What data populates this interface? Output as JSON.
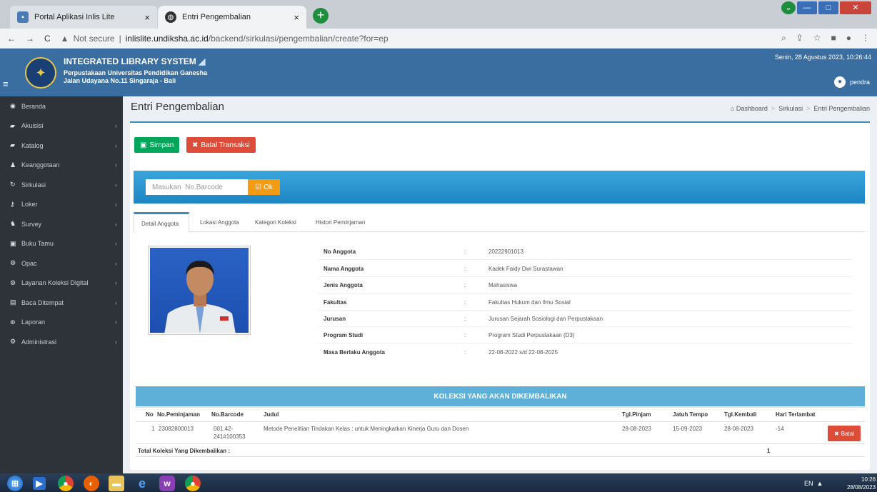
{
  "browser": {
    "tabs": [
      {
        "title": "Portal Aplikasi Inlis Lite"
      },
      {
        "title": "Entri Pengembalian"
      }
    ],
    "url_security": "Not secure",
    "url_host": "inlislite.undiksha.ac.id",
    "url_path": "/backend/sirkulasi/pengembalian/create?for=ep"
  },
  "header": {
    "title": "INTEGRATED LIBRARY SYSTEM",
    "subtitle1": "Perpustakaan Universitas Pendidikan Ganesha",
    "subtitle2": "Jalan Udayana No.11 Singaraja - Bali",
    "datetime": "Senin, 28 Agustus 2023, 10:26:44",
    "user": "pendra"
  },
  "sidebar": {
    "items": [
      {
        "label": "Beranda",
        "icon": "dashboard-icon"
      },
      {
        "label": "Akuisisi",
        "icon": "book-icon"
      },
      {
        "label": "Katalog",
        "icon": "book-icon"
      },
      {
        "label": "Keanggotaan",
        "icon": "user-icon"
      },
      {
        "label": "Sirkulasi",
        "icon": "refresh-icon"
      },
      {
        "label": "Loker",
        "icon": "key-icon"
      },
      {
        "label": "Survey",
        "icon": "users-icon"
      },
      {
        "label": "Buku Tamu",
        "icon": "guestbook-icon"
      },
      {
        "label": "Opac",
        "icon": "cogs-icon"
      },
      {
        "label": "Layanan Koleksi Digital",
        "icon": "cogs-icon"
      },
      {
        "label": "Baca Ditempat",
        "icon": "table-icon"
      },
      {
        "label": "Laporan",
        "icon": "report-icon"
      },
      {
        "label": "Administrasi",
        "icon": "cogs-icon"
      }
    ]
  },
  "page": {
    "title": "Entri Pengembalian",
    "breadcrumb": [
      "Dashboard",
      "Sirkulasi",
      "Entri Pengembalian"
    ],
    "save_label": "Simpan",
    "cancel_label": "Batal Transaksi",
    "barcode_placeholder": "Masukan  No.Barcode",
    "ok_label": "Ok"
  },
  "tabs": [
    "Detail Anggota",
    "Lokasi Anggota",
    "Kategori Koleksi",
    "Histori Peminjaman"
  ],
  "member": {
    "fields": [
      {
        "label": "No Anggota",
        "value": "20222901013"
      },
      {
        "label": "Nama Anggota",
        "value": "Kadek Faidy Dwi Surastawan"
      },
      {
        "label": "Jenis Anggota",
        "value": "Mahasiswa"
      },
      {
        "label": "Fakultas",
        "value": "Fakultas Hukum dan Ilmu Sosial"
      },
      {
        "label": "Jurusan",
        "value": "Jurusan Sejarah Sosiologi dan Perpustakaan"
      },
      {
        "label": "Program Studi",
        "value": "Program Studi Perpustakaan (D3)"
      },
      {
        "label": "Masa Berlaku Anggota",
        "value": "22-08-2022 s/d 22-08-2025"
      }
    ]
  },
  "collection": {
    "title": "KOLEKSI YANG AKAN DIKEMBALIKAN",
    "headers": [
      "No",
      "No.Peminjaman",
      "No.Barcode",
      "Judul",
      "Tgl.Pinjam",
      "Jatuh Tempo",
      "Tgl.Kembali",
      "Hari Terlambat"
    ],
    "rows": [
      {
        "no": "1",
        "peminjaman": "23082800013",
        "barcode_line1": "001.42-",
        "barcode_line2": "241#100353",
        "judul": "Metode Penelitian Tindakan Kelas : untuk Meningkatkan Kinerja Guru dan Dosen",
        "tgl_pinjam": "28-08-2023",
        "jatuh_tempo": "15-09-2023",
        "tgl_kembali": "28-08-2023",
        "hari_terlambat": "-14",
        "action": "Batal"
      }
    ],
    "total_label": "Total Koleksi Yang Dikembalikan :",
    "total_value": "1"
  },
  "taskbar": {
    "lang": "EN",
    "time": "10:26",
    "date": "28/08/2023"
  }
}
